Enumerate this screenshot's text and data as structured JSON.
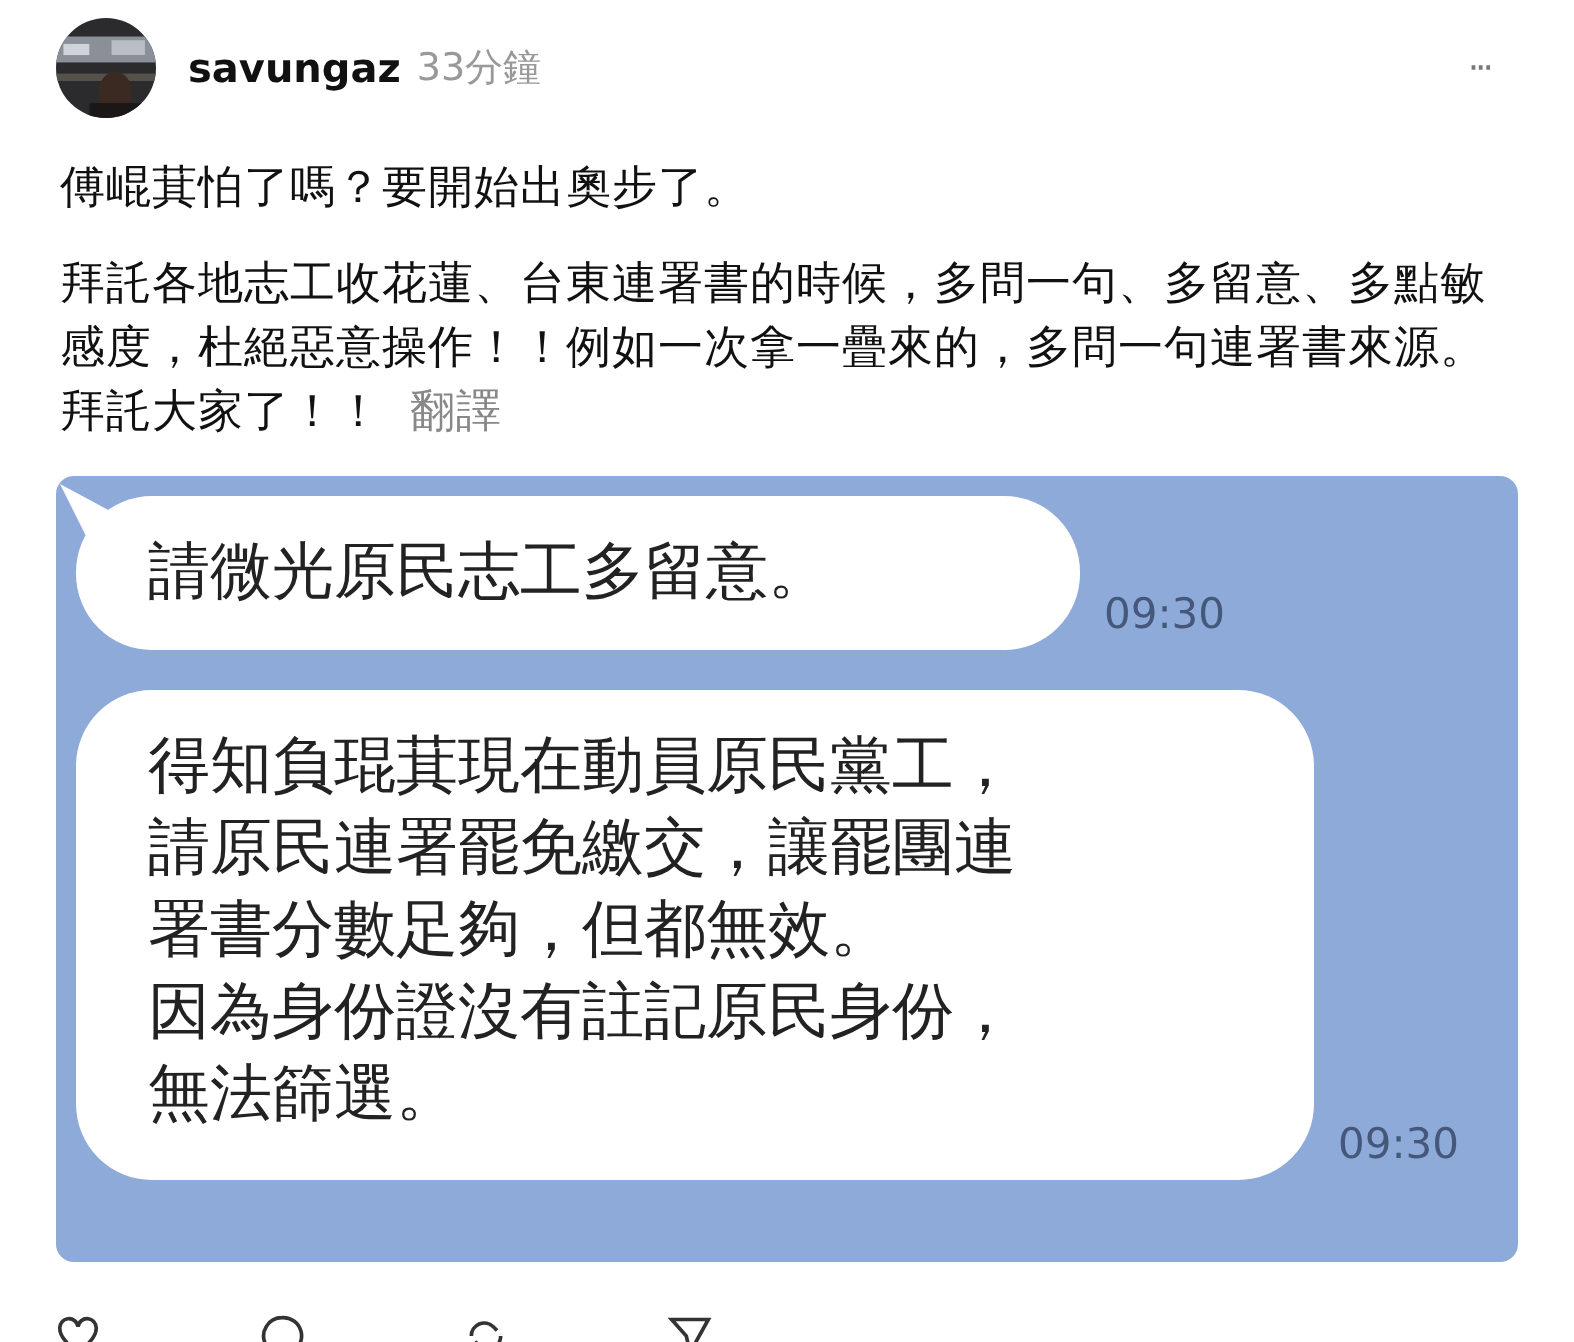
{
  "post": {
    "author": "savungaz",
    "time": "33分鐘",
    "more": "···",
    "paragraphs": [
      "傅崐萁怕了嗎？要開始出奧步了。",
      "拜託各地志工收花蓮、台東連署書的時候，多問一句、多留意、多點敏感度，杜絕惡意操作！！例如一次拿一疊來的，多問一句連署書來源。拜託大家了！！"
    ],
    "translate": "翻譯",
    "chat": [
      {
        "lines": [
          "請微光原民志工多留意。"
        ],
        "time": "09:30",
        "tail": true
      },
      {
        "lines": [
          "得知負琨萁現在動員原民黨工，",
          "請原民連署罷免繳交，讓罷團連",
          "署書分數足夠，但都無效。",
          "因為身份證沒有註記原民身份，",
          "無法篩選。"
        ],
        "time": "09:30",
        "tail": false
      }
    ],
    "actions": [
      {
        "kind": "like"
      },
      {
        "kind": "reply"
      },
      {
        "kind": "repost"
      },
      {
        "kind": "share"
      }
    ]
  }
}
